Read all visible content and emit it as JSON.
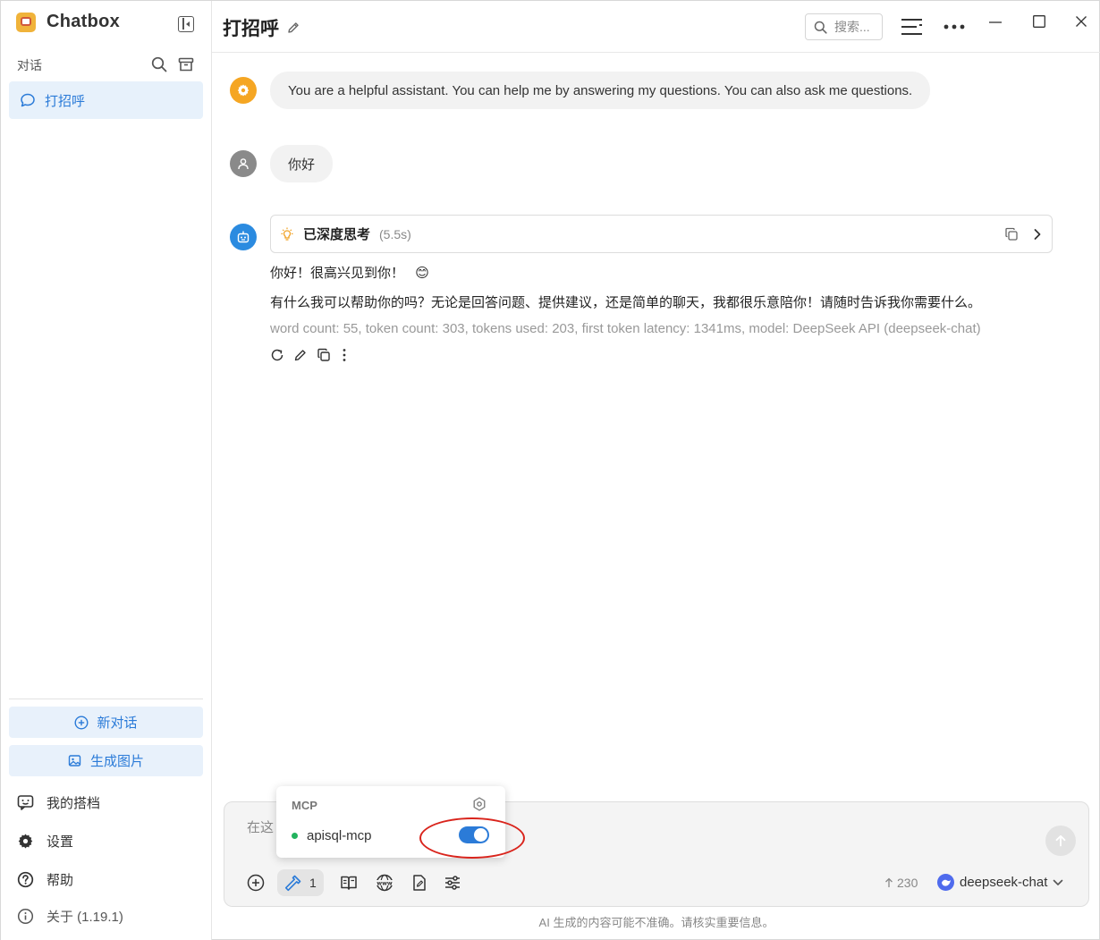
{
  "app": {
    "name": "Chatbox",
    "version_label": "关于 (1.19.1)"
  },
  "sidebar": {
    "section_label": "对话",
    "conversations": [
      {
        "label": "打招呼",
        "active": true
      }
    ],
    "new_chat_label": "新对话",
    "generate_image_label": "生成图片",
    "links": [
      {
        "label": "我的搭档",
        "icon": "partner-icon"
      },
      {
        "label": "设置",
        "icon": "gear-icon"
      },
      {
        "label": "帮助",
        "icon": "help-icon"
      }
    ]
  },
  "header": {
    "title": "打招呼",
    "search_placeholder": "搜索..."
  },
  "messages": {
    "system": "You are a helpful assistant. You can help me by answering my questions. You can also ask me questions.",
    "user": "你好",
    "assistant": {
      "thinking_label": "已深度思考",
      "thinking_time": "(5.5s)",
      "line1": "你好！很高兴见到你！",
      "line1_emoji": "😊",
      "line2": "有什么我可以帮助你的吗？无论是回答问题、提供建议，还是简单的聊天，我都很乐意陪你！请随时告诉我你需要什么。",
      "meta": "word count: 55, token count: 303, tokens used: 203, first token latency: 1341ms, model: DeepSeek API (deepseek-chat)"
    }
  },
  "input": {
    "placeholder": "在这",
    "tool_count": "1",
    "token_estimate": "230",
    "model": "deepseek-chat"
  },
  "mcp_popover": {
    "title": "MCP",
    "servers": [
      {
        "name": "apisql-mcp",
        "status": "active",
        "enabled": true
      }
    ]
  },
  "disclaimer": "AI 生成的内容可能不准确。请核实重要信息。",
  "colors": {
    "accent": "#2b7bd8",
    "accent_bg": "#e7f1fb",
    "system_avatar": "#f5a623",
    "user_avatar": "#8a8a8a",
    "bot_avatar": "#2b8be0",
    "status_green": "#22b35e",
    "annotation_red": "#d9241c"
  }
}
